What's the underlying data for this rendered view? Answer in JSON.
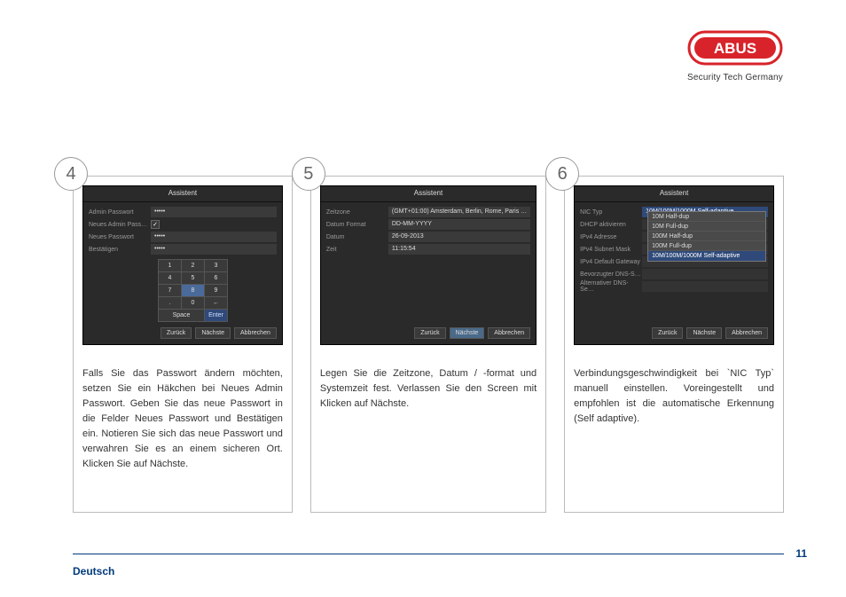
{
  "brand": {
    "name": "ABUS",
    "tagline": "Security Tech Germany",
    "color": "#d8232a"
  },
  "page": {
    "number": "11",
    "language": "Deutsch"
  },
  "wizard_title": "Assistent",
  "buttons": {
    "back": "Zurück",
    "next": "Nächste",
    "cancel": "Abbrechen"
  },
  "keypad": {
    "keys": [
      [
        "1",
        "2",
        "3"
      ],
      [
        "4",
        "5",
        "6"
      ],
      [
        "7",
        "8",
        "9"
      ],
      [
        ".",
        "0",
        "←"
      ]
    ],
    "space": "Space",
    "enter": "Enter"
  },
  "steps": [
    {
      "num": "4",
      "screen": {
        "rows": [
          {
            "label": "Admin Passwort",
            "value": "•••••",
            "kind": "text"
          },
          {
            "label": "Neues Admin Pass…",
            "checked": true,
            "kind": "checkbox"
          },
          {
            "label": "Neues Passwort",
            "value": "•••••",
            "kind": "text"
          },
          {
            "label": "Bestätigen",
            "value": "•••••",
            "kind": "text"
          }
        ]
      },
      "desc": "Falls Sie das Passwort ändern möchten, setzen Sie ein Häkchen bei Neues Admin Passwort. Geben Sie das neue Passwort in die Felder Neues Passwort und Bestätigen ein. Notieren Sie sich das neue Passwort und verwahren Sie es an einem sicheren Ort. Klicken Sie auf Nächste."
    },
    {
      "num": "5",
      "screen": {
        "rows": [
          {
            "label": "Zeitzone",
            "value": "(GMT+01:00) Amsterdam, Berlin, Rome, Paris …",
            "kind": "text"
          },
          {
            "label": "Datum Format",
            "value": "DD-MM-YYYY",
            "kind": "text"
          },
          {
            "label": "Datum",
            "value": "26-09-2013",
            "kind": "text"
          },
          {
            "label": "Zeit",
            "value": "11:15:54",
            "kind": "text"
          }
        ]
      },
      "desc": "Legen Sie die Zeitzone, Datum / -format und Systemzeit fest. Verlassen Sie den Screen mit Klicken auf Nächste."
    },
    {
      "num": "6",
      "screen": {
        "rows": [
          {
            "label": "NIC Typ",
            "value": "10M/100M/1000M Self-adaptive",
            "kind": "text",
            "selected": true
          },
          {
            "label": "DHCP aktivieren",
            "value": "",
            "kind": "dim"
          },
          {
            "label": "IPv4 Adresse",
            "value": "",
            "kind": "dim"
          },
          {
            "label": "IPv4 Subnet Mask",
            "value": "",
            "kind": "dim"
          },
          {
            "label": "IPv4 Default Gateway",
            "value": "",
            "kind": "dim"
          },
          {
            "label": "Bevorzugter DNS-S…",
            "value": "",
            "kind": "dim"
          },
          {
            "label": "Alternativer DNS-Se…",
            "value": "",
            "kind": "dim"
          }
        ],
        "dropdown": [
          "10M Half-dup",
          "10M Full-dup",
          "100M Half-dup",
          "100M Full-dup",
          "10M/100M/1000M Self-adaptive"
        ],
        "dropdown_selected": "10M/100M/1000M Self-adaptive"
      },
      "desc": "Verbindungsgeschwindigkeit bei `NIC Typ` manuell einstellen. Voreingestellt und empfohlen ist die automatische Erkennung (Self adaptive)."
    }
  ]
}
